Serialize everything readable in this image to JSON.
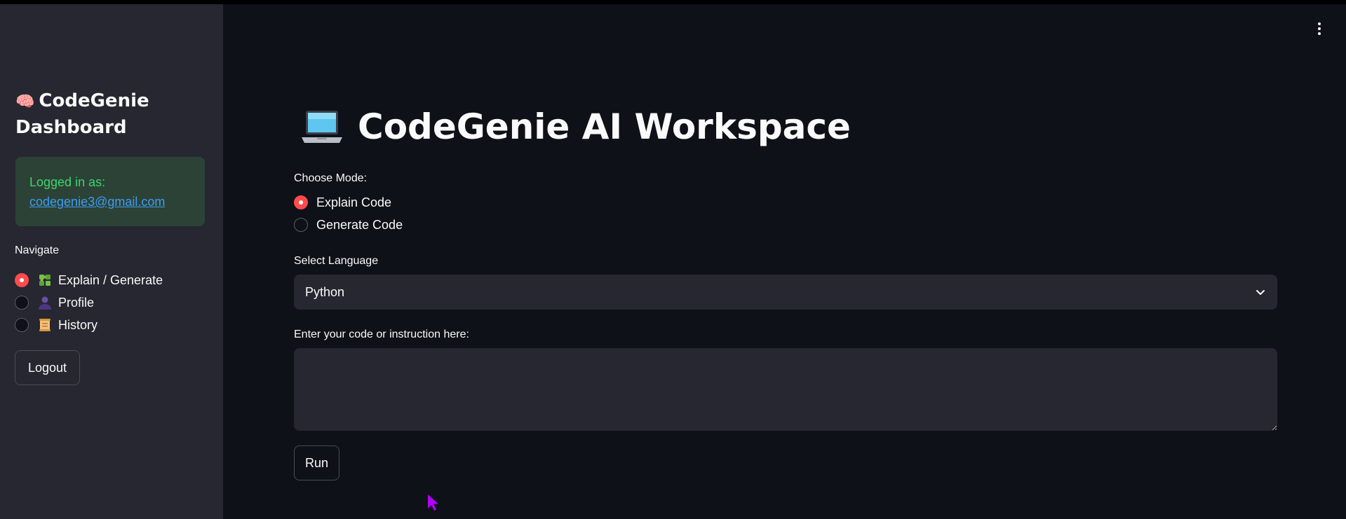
{
  "sidebar": {
    "brand_emoji": "🧠",
    "brand_title": "CodeGenie Dashboard",
    "login": {
      "label": "Logged in as:",
      "email": "codegenie3@gmail.com"
    },
    "nav_label": "Navigate",
    "nav_items": [
      {
        "label": "Explain / Generate",
        "icon": "puzzle-icon",
        "selected": true
      },
      {
        "label": "Profile",
        "icon": "person-icon",
        "selected": false
      },
      {
        "label": "History",
        "icon": "scroll-icon",
        "selected": false
      }
    ],
    "logout_label": "Logout"
  },
  "main": {
    "title": "CodeGenie AI Workspace",
    "title_icon": "laptop-icon",
    "mode_label": "Choose Mode:",
    "modes": [
      {
        "label": "Explain Code",
        "selected": true
      },
      {
        "label": "Generate Code",
        "selected": false
      }
    ],
    "language_label": "Select Language",
    "language_value": "Python",
    "code_label": "Enter your code or instruction here:",
    "code_value": "",
    "run_label": "Run"
  },
  "colors": {
    "background": "#0e1117",
    "sidebar": "#262730",
    "accent": "#ff4b4b",
    "success_bg": "#2c4236",
    "success_text": "#3dd56d",
    "link": "#3d9df3"
  }
}
